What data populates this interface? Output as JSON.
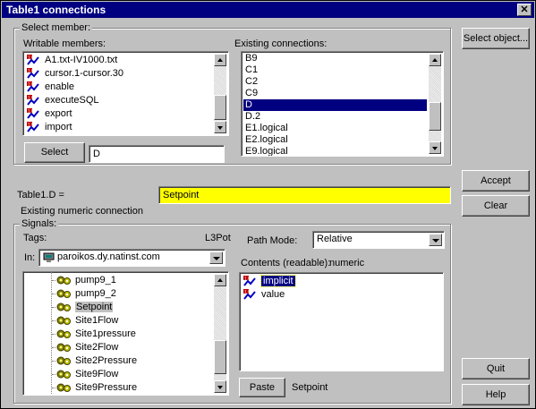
{
  "window": {
    "title": "Table1 connections",
    "close_glyph": "✕"
  },
  "select_member": {
    "group_label": "Select member:",
    "writable_label": "Writable members:",
    "writable_items": [
      "A1.txt-IV1000.txt",
      "cursor.1-cursor.30",
      "enable",
      "executeSQL",
      "export",
      "import"
    ],
    "existing_label": "Existing connections:",
    "existing_items": [
      "B9",
      "C1",
      "C2",
      "C9",
      "D",
      "D.2",
      "E1.logical",
      "E2.logical",
      "E9.logical"
    ],
    "existing_selected": "D",
    "select_button": "Select",
    "select_value": "D"
  },
  "buttons": {
    "select_object": "Select object...",
    "accept": "Accept",
    "clear": "Clear",
    "quit": "Quit",
    "help": "Help",
    "paste": "Paste"
  },
  "connection": {
    "label": "Table1.D =",
    "value": "Setpoint",
    "value_bg": "#ffff00",
    "note": "Existing numeric connection"
  },
  "signals": {
    "group_label": "Signals:",
    "tags_label": "Tags:",
    "tags_right": "L3Pot",
    "in_label": "In:",
    "in_value": "paroikos.dy.natinst.com",
    "tree_items": [
      "pump9_1",
      "pump9_2",
      "Setpoint",
      "Site1Flow",
      "Site1pressure",
      "Site2Flow",
      "Site2Pressure",
      "Site9Flow",
      "Site9Pressure"
    ],
    "tree_selected": "Setpoint",
    "path_mode_label": "Path Mode:",
    "path_mode_value": "Relative",
    "contents_label": "Contents (readable):",
    "contents_type": "numeric",
    "contents_items": [
      "implicit",
      "value"
    ],
    "paste_value": "Setpoint"
  },
  "colors": {
    "title_bg": "#000080",
    "selection": "#000080",
    "face": "#c0c0c0"
  }
}
